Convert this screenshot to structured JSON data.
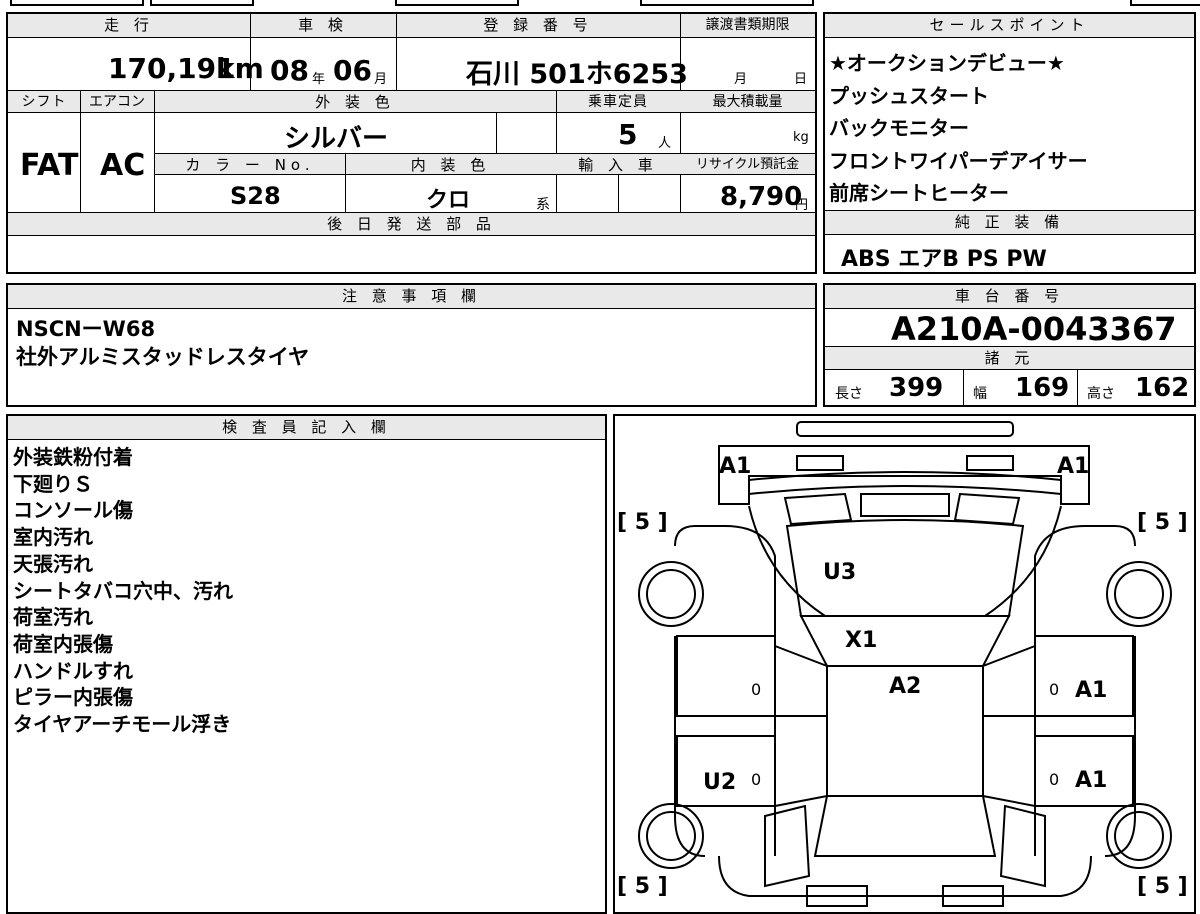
{
  "vehicle": {
    "mileage_header": "走 行",
    "mileage_value": "170,191",
    "mileage_unit": "km",
    "inspection_header": "車 検",
    "inspection_year": "08",
    "inspection_year_unit": "年",
    "inspection_month": "06",
    "inspection_month_unit": "月",
    "registration_header": "登 録 番 号",
    "registration_value": "石川 501ホ6253",
    "transfer_header": "譲渡書類期限",
    "transfer_month_unit": "月",
    "transfer_day_unit": "日",
    "shift_header": "シフト",
    "shift_value": "FAT",
    "aircon_header": "エアコン",
    "aircon_value": "AC",
    "exterior_color_header": "外 装 色",
    "exterior_color_value": "シルバー",
    "color_no_header": "カ ラ ー No.",
    "color_no_value": "S28",
    "interior_color_header": "内 装 色",
    "interior_color_value": "クロ",
    "interior_color_unit": "系",
    "capacity_header": "乗車定員",
    "capacity_value": "5",
    "capacity_unit": "人",
    "max_load_header": "最大積載量",
    "max_load_unit": "kg",
    "import_header": "輸 入 車",
    "recycle_header": "リサイクル預託金",
    "recycle_value": "8,790",
    "recycle_unit": "円",
    "later_parts_header": "後 日 発 送 部 品"
  },
  "sales_points": {
    "header": "セールスポイント",
    "items": [
      "★オークションデビュー★",
      "プッシュスタート",
      "バックモニター",
      "フロントワイパーデアイサー",
      "前席シートヒーター"
    ]
  },
  "genuine_equipment": {
    "header": "純 正 装 備",
    "value": "ABS エアB PS PW"
  },
  "notes": {
    "header": "注 意 事 項 欄",
    "lines": [
      "NSCNーW68",
      "社外アルミスタッドレスタイヤ"
    ]
  },
  "chassis": {
    "header": "車 台 番 号",
    "value": "A210A-0043367"
  },
  "specs": {
    "header": "諸 元",
    "length_label": "長さ",
    "length_value": "399",
    "width_label": "幅",
    "width_value": "169",
    "height_label": "高さ",
    "height_value": "162"
  },
  "inspector": {
    "header": "検 査 員 記 入 欄",
    "lines": [
      "外装鉄粉付着",
      "下廻りＳ",
      "コンソール傷",
      "室内汚れ",
      "天張汚れ",
      "シートタバコ穴中、汚れ",
      "荷室汚れ",
      "荷室内張傷",
      "ハンドルすれ",
      "ピラー内張傷",
      "タイヤアーチモール浮き"
    ]
  },
  "diagram": {
    "marks": {
      "front_left": "A1",
      "front_right": "A1",
      "hood": "U3",
      "windshield": "X1",
      "roof": "A2",
      "front_door_right": "A1",
      "rear_door_right": "A1",
      "rear_door_left": "U2"
    },
    "tire_depth": {
      "front_left": "[ 5 ]",
      "front_right": "[ 5 ]",
      "rear_left": "[ 5 ]",
      "rear_right": "[ 5 ]"
    },
    "door_zero": "0"
  }
}
